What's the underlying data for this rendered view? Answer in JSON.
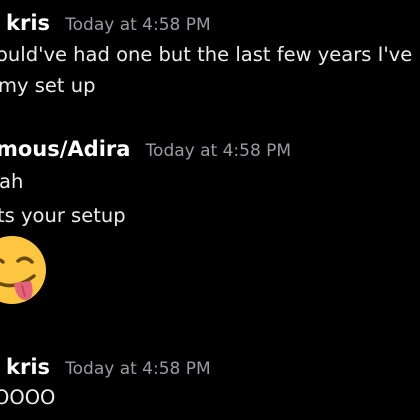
{
  "messages": [
    {
      "author": "kris",
      "timestamp": "Today at 4:58 PM",
      "lines": [
        "ould've had one but the last few years I've bee",
        "my set up"
      ]
    },
    {
      "author": "mous/Adira",
      "timestamp": "Today at 4:58 PM",
      "lines": [
        "ah",
        "ts your setup"
      ],
      "emoji": "face-savoring-food-icon"
    },
    {
      "author": "kris",
      "timestamp": "Today at 4:58 PM",
      "lines": [
        "OOOO"
      ]
    }
  ],
  "colors": {
    "background": "#000000",
    "author": "#ffffff",
    "timestamp": "#9a9aa0",
    "message_text": "#ececec",
    "emoji_face": "#fdc640",
    "emoji_tongue": "#e5637a"
  }
}
